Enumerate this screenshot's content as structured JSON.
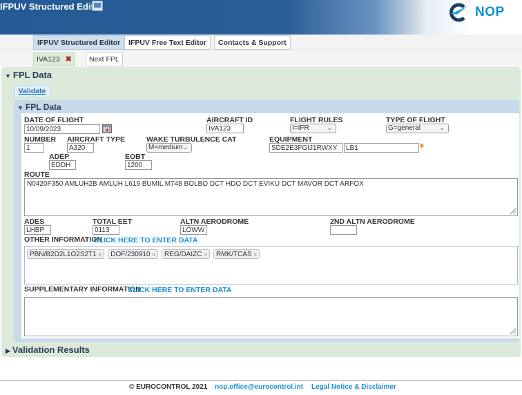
{
  "header": {
    "app_title": "IFPUV Structured Editor",
    "logo_text": "NOP"
  },
  "tabs": [
    {
      "label": "IFPUV Structured Editor",
      "active": true
    },
    {
      "label": "IFPUV Free Text Editor",
      "active": false
    },
    {
      "label": "Contacts & Support",
      "active": false
    }
  ],
  "subtabs": [
    {
      "label": "IVA123",
      "active": true,
      "closable": true
    },
    {
      "label": "Next FPL",
      "active": false
    }
  ],
  "outer_section": {
    "title": "FPL Data"
  },
  "validate_label": "Validate",
  "inner_section": {
    "title": "FPL Data"
  },
  "form": {
    "date_of_flight": {
      "label": "DATE OF FLIGHT",
      "value": "10/09/2023"
    },
    "aircraft_id": {
      "label": "AIRCRAFT ID",
      "value": "IVA123"
    },
    "flight_rules": {
      "label": "FLIGHT RULES",
      "value": "I=IFR"
    },
    "type_of_flight": {
      "label": "TYPE OF FLIGHT",
      "value": "G=general"
    },
    "number": {
      "label": "NUMBER",
      "value": "1"
    },
    "aircraft_type": {
      "label": "AIRCRAFT TYPE",
      "value": "A320"
    },
    "wake_turbulence": {
      "label": "WAKE TURBULENCE CAT",
      "value": "M=medium"
    },
    "equipment": {
      "label": "EQUIPMENT",
      "value1": "SDE2E3FGIJ1RWXY",
      "value2": "LB1"
    },
    "adep": {
      "label": "ADEP",
      "value": "EDDH"
    },
    "eobt": {
      "label": "EOBT",
      "value": "1200"
    },
    "route": {
      "label": "ROUTE",
      "value": "N0420F350 AMLUH2B AMLUH L619  BUMIL M748  BOLBO DCT HDO DCT EVIKU DCT MAVOR DCT ARFOX"
    },
    "ades": {
      "label": "ADES",
      "value": "LHBP"
    },
    "total_eet": {
      "label": "TOTAL EET",
      "value": "0113"
    },
    "altn": {
      "label": "ALTN AERODROME",
      "value": "LOWW"
    },
    "altn2": {
      "label": "2ND ALTN AERODROME",
      "value": ""
    },
    "other_info": {
      "label": "OTHER INFORMATION",
      "link": "CLICK HERE TO ENTER DATA",
      "chips": [
        "PBN/B2D2L1O2S2T1",
        "DOF/230910",
        "REG/DAIZC",
        "RMK/TCAS"
      ]
    },
    "supp_info": {
      "label": "SUPPLEMENTARY INFORMATION",
      "link": "CLICK HERE TO ENTER DATA",
      "value": ""
    }
  },
  "validation_section": {
    "title": "Validation Results"
  },
  "footer": {
    "copyright": "© EUROCONTROL 2021",
    "email": "nop.office@eurocontrol.int",
    "legal": "Legal Notice & Disclaimer"
  },
  "colors": {
    "header_blue": "#245a95",
    "link_blue": "#1a8fd6",
    "outer_panel_green": "#dbeadb",
    "inner_panel_blue": "#c8d9ea",
    "close_red": "#c0282a"
  }
}
